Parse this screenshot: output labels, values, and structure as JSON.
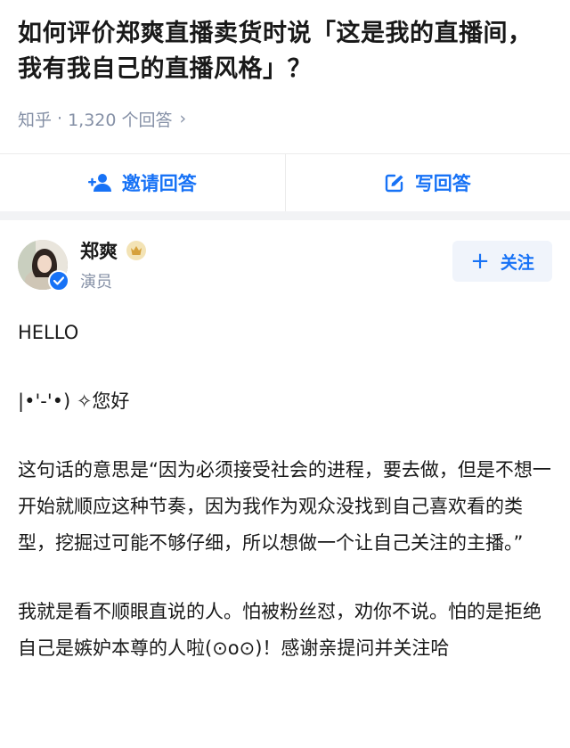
{
  "question": {
    "title": "如何评价郑爽直播卖货时说「这是我的直播间，我有我自己的直播风格」？",
    "source": "知乎",
    "separator": "·",
    "answer_count": "1,320 个回答",
    "chevron": "›"
  },
  "actions": {
    "invite_label": "邀请回答",
    "write_label": "写回答",
    "accent_color": "#1772f6"
  },
  "answer": {
    "author_name": "郑爽",
    "author_title": "演员",
    "follow_plus": "+",
    "follow_label": "关注",
    "paragraphs": [
      "HELLO",
      "|•'-'•) ✧您好",
      "这句话的意思是“因为必须接受社会的进程，要去做，但是不想一开始就顺应这种节奏，因为我作为观众没找到自己喜欢看的类型，挖掘过可能不够仔细，所以想做一个让自己关注的主播。”",
      "我就是看不顺眼直说的人。怕被粉丝怼，劝你不说。怕的是拒绝自己是嫉妒本尊的人啦(⊙o⊙)！感谢亲提问并关注哈"
    ]
  }
}
